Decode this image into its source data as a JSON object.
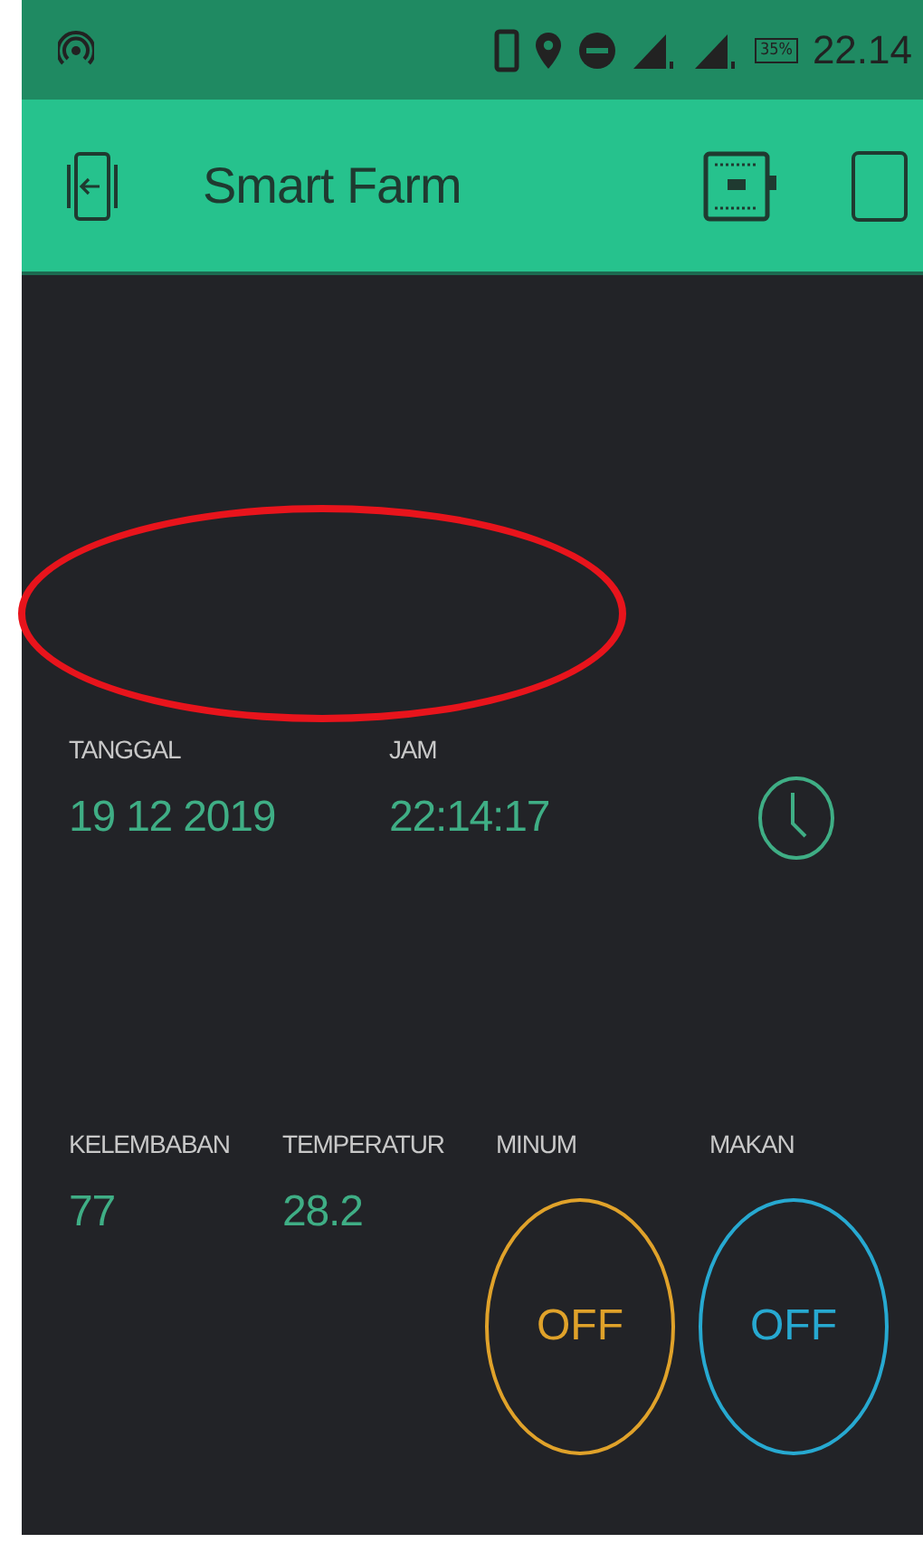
{
  "status_bar": {
    "battery": "35%",
    "time": "22.14"
  },
  "app_bar": {
    "title": "Smart Farm"
  },
  "clock_widgets": [
    {
      "label": "TANGGAL",
      "value": "19 12 2019"
    },
    {
      "label": "JAM",
      "value": "22:14:17"
    }
  ],
  "widgets": [
    {
      "kind": "display",
      "label": "KELEMBABAN",
      "value": "77"
    },
    {
      "kind": "display",
      "label": "TEMPERATUR",
      "value": "28.2"
    },
    {
      "kind": "button",
      "label": "MINUM",
      "value": "OFF",
      "on": false,
      "color": "#e0a22a"
    },
    {
      "kind": "button",
      "label": "MAKAN",
      "value": "OFF",
      "on": false,
      "color": "#27a9d1"
    }
  ]
}
